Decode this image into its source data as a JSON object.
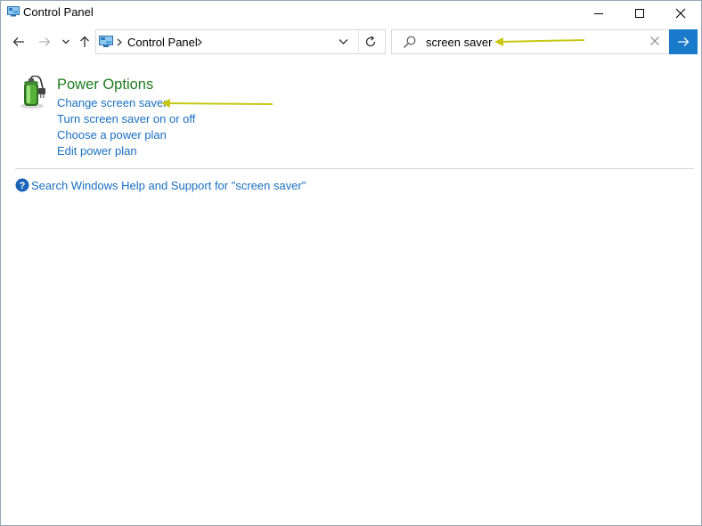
{
  "window": {
    "title": "Control Panel",
    "controls": {
      "minimize_icon": "minimize-icon",
      "maximize_icon": "maximize-icon",
      "close_icon": "close-icon"
    }
  },
  "navigation": {
    "back_icon": "arrow-left-icon",
    "forward_icon": "arrow-right-icon",
    "recent_icon": "chevron-down-icon",
    "up_icon": "arrow-up-icon",
    "breadcrumb": [
      "Control Panel"
    ],
    "refresh_icon": "refresh-icon"
  },
  "search": {
    "value": "screen saver",
    "placeholder": "",
    "accent_color": "#1979ca"
  },
  "results": {
    "group_title": "Power Options",
    "group_icon": "battery-plug-icon",
    "group_title_color": "#1e7b1e",
    "links": [
      "Change screen saver",
      "Turn screen saver on or off",
      "Choose a power plan",
      "Edit power plan"
    ],
    "link_color": "#1a6fc1"
  },
  "help": {
    "icon": "question-circle-icon",
    "link": "Search Windows Help and Support for \"screen saver\""
  },
  "annotations": {
    "arrow_color": "#c8c813"
  }
}
